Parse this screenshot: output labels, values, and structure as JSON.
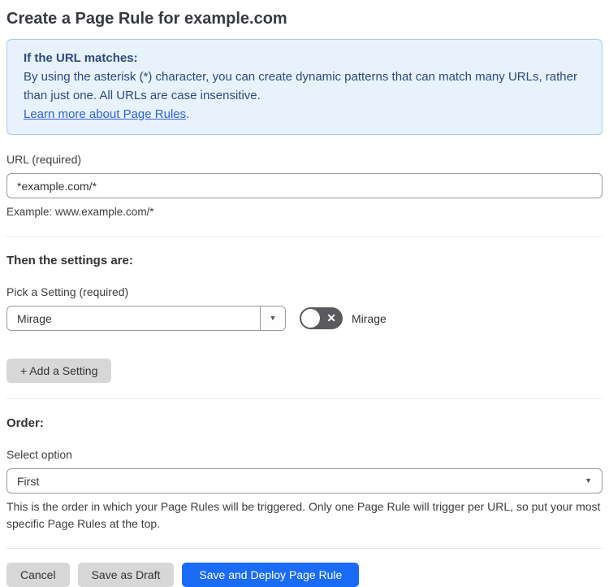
{
  "page": {
    "title": "Create a Page Rule for example.com"
  },
  "info_box": {
    "heading": "If the URL matches:",
    "body": "By using the asterisk (*) character, you can create dynamic patterns that can match many URLs, rather than just one. All URLs are case insensitive.",
    "link_label": "Learn more about Page Rules",
    "link_suffix": "."
  },
  "url_field": {
    "label": "URL (required)",
    "value": "*example.com/*",
    "helper": "Example: www.example.com/*"
  },
  "settings_section": {
    "heading": "Then the settings are:",
    "setting_label": "Pick a Setting (required)",
    "setting_value": "Mirage",
    "toggle_label": "Mirage",
    "toggle_state": "off",
    "add_button_label": "+ Add a Setting"
  },
  "order_section": {
    "heading": "Order:",
    "select_label": "Select option",
    "select_value": "First",
    "helper": "This is the order in which your Page Rules will be triggered. Only one Page Rule will trigger per URL, so put your most specific Page Rules at the top."
  },
  "footer": {
    "cancel_label": "Cancel",
    "save_draft_label": "Save as Draft",
    "save_deploy_label": "Save and Deploy Page Rule"
  },
  "icons": {
    "dropdown_arrow_glyph": "▼",
    "toggle_x_glyph": "✕"
  },
  "colors": {
    "accent_blue": "#1a6cf5",
    "info_background": "#e8f2fc",
    "info_border": "#aacaf0",
    "info_text": "#2c4a7e",
    "link_blue": "#2c64d8",
    "toggle_off_background": "#5a5a5e",
    "gray_button": "#d7d7d7"
  }
}
